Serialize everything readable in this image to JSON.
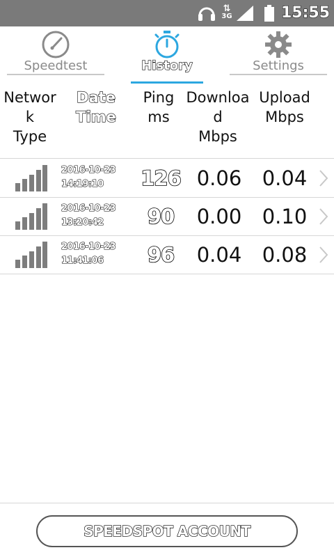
{
  "status_bar": {
    "time": "15:55",
    "network_type": "3G",
    "data_arrows": "⇅",
    "icons": [
      "headset-icon",
      "data-arrows-icon",
      "signal-icon",
      "battery-icon"
    ]
  },
  "tabs": [
    {
      "label": "Speedtest",
      "icon": "speedometer-icon",
      "active": false
    },
    {
      "label": "History",
      "icon": "stopwatch-icon",
      "active": true
    },
    {
      "label": "Settings",
      "icon": "gear-icon",
      "active": false
    }
  ],
  "columns": {
    "network_type": "Networ\nk\nType",
    "date_time": "Date\nTime",
    "ping": "Ping\nms",
    "download": "Downloa\nd\nMbps",
    "upload": "Upload\nMbps"
  },
  "rows": [
    {
      "date": "2016-10-23",
      "time": "14:19:10",
      "ping": "126",
      "download": "0.06",
      "upload": "0.04"
    },
    {
      "date": "2016-10-23",
      "time": "13:20:42",
      "ping": "90",
      "download": "0.00",
      "upload": "0.10"
    },
    {
      "date": "2016-10-23",
      "time": "11:41:06",
      "ping": "96",
      "download": "0.04",
      "upload": "0.08"
    }
  ],
  "footer": {
    "account_button": "SPEEDSPOT ACCOUNT"
  },
  "colors": {
    "accent": "#2ca7e0",
    "status_bar": "#7a7a7a",
    "inactive": "#8a8a8a",
    "signal_bars": "#7d7d7d"
  }
}
